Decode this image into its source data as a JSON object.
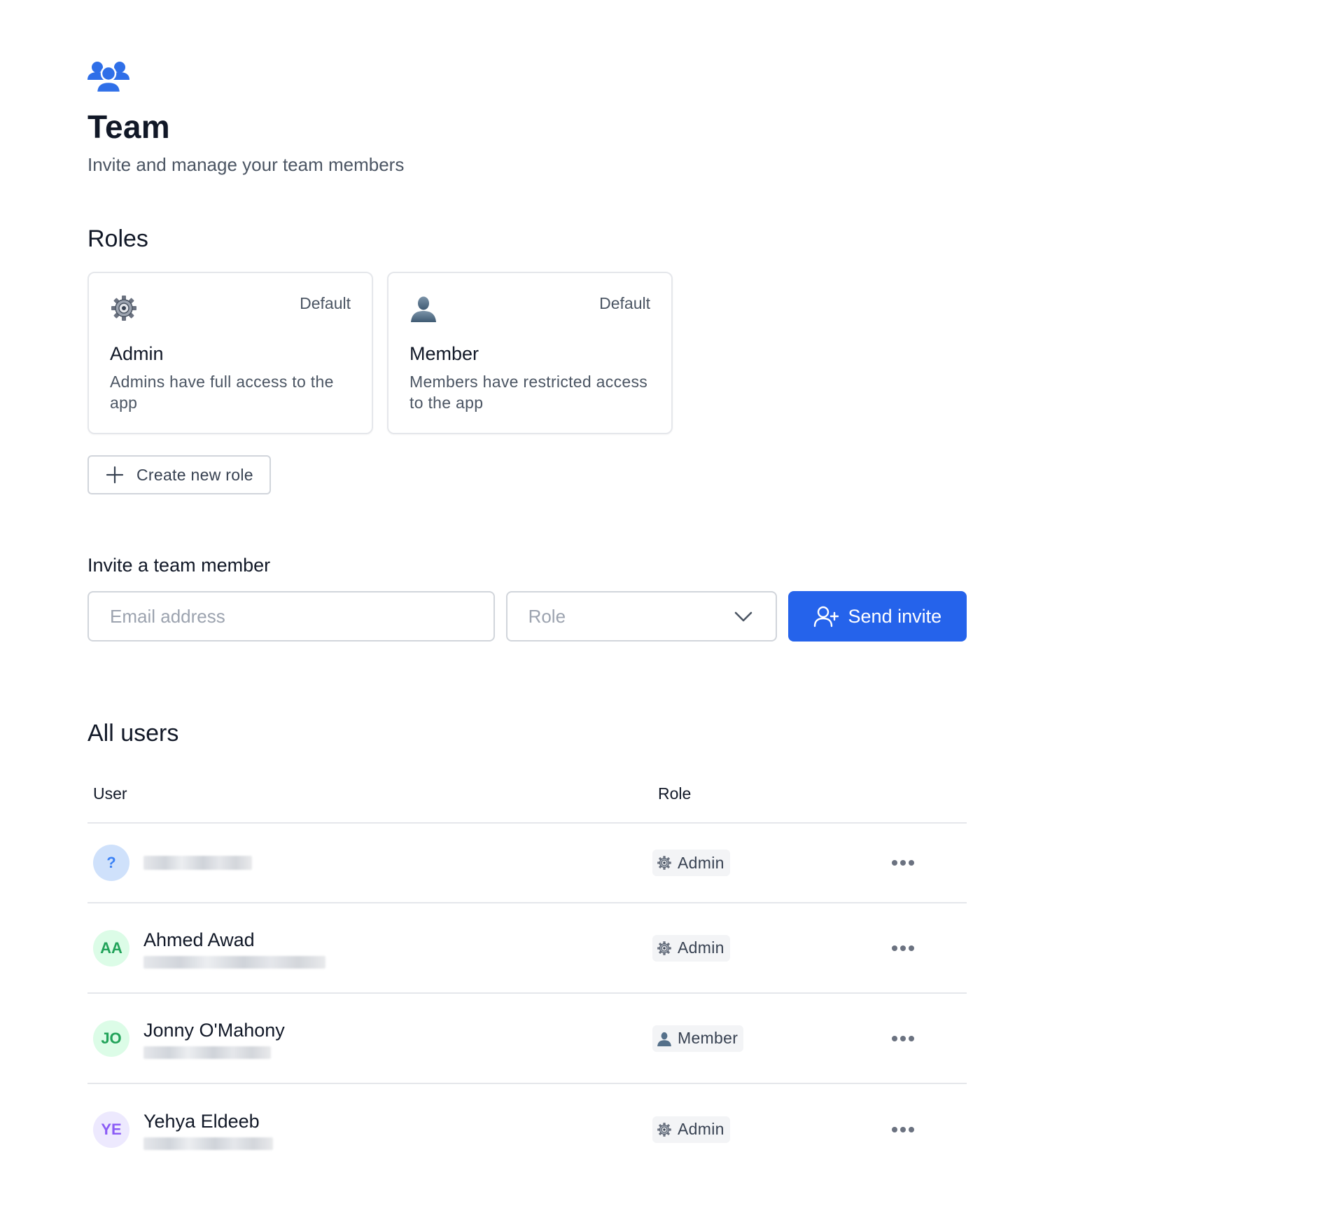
{
  "header": {
    "icon": "team-icon",
    "title": "Team",
    "subtitle": "Invite and manage your team members"
  },
  "roles": {
    "title": "Roles",
    "cards": [
      {
        "icon": "gear-icon",
        "badge": "Default",
        "name": "Admin",
        "description": "Admins have full access to the app"
      },
      {
        "icon": "user-silhouette-icon",
        "badge": "Default",
        "name": "Member",
        "description": "Members have restricted access to the app"
      }
    ],
    "create_label": "Create new role"
  },
  "invite": {
    "title": "Invite a team member",
    "email_placeholder": "Email address",
    "email_value": "",
    "role_placeholder": "Role",
    "send_label": "Send invite"
  },
  "users": {
    "title": "All users",
    "columns": {
      "user": "User",
      "role": "Role"
    },
    "rows": [
      {
        "initials": "?",
        "name": "",
        "avatar_bg": "#cfe1fb",
        "avatar_fg": "#3b82f6",
        "role": "Admin",
        "role_icon": "gear-icon"
      },
      {
        "initials": "AA",
        "name": "Ahmed Awad",
        "avatar_bg": "#dcfce7",
        "avatar_fg": "#22a35a",
        "role": "Admin",
        "role_icon": "gear-icon"
      },
      {
        "initials": "JO",
        "name": "Jonny O'Mahony",
        "avatar_bg": "#dcfce7",
        "avatar_fg": "#22a35a",
        "role": "Member",
        "role_icon": "user-silhouette-icon"
      },
      {
        "initials": "YE",
        "name": "Yehya Eldeeb",
        "avatar_bg": "#ede9fe",
        "avatar_fg": "#8b5cf6",
        "role": "Admin",
        "role_icon": "gear-icon"
      }
    ]
  },
  "colors": {
    "accent": "#2563eb",
    "border": "#e5e7eb"
  }
}
